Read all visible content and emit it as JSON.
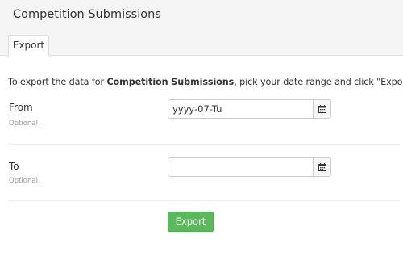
{
  "header": {
    "title": "Competition Submissions"
  },
  "tabs": [
    {
      "label": "Export"
    }
  ],
  "intro": {
    "prefix": "To export the data for ",
    "subject": "Competition Submissions",
    "suffix": ", pick your date range and click \"Export\"."
  },
  "form": {
    "from": {
      "label": "From",
      "hint": "Optional.",
      "value": "yyyy-07-Tu",
      "icon": "calendar-icon"
    },
    "to": {
      "label": "To",
      "hint": "Optional.",
      "value": "",
      "icon": "calendar-icon"
    },
    "submit_label": "Export"
  },
  "colors": {
    "header_bg": "#f5f5f5",
    "button_green": "#5cb85c",
    "hint_gray": "#999999"
  }
}
